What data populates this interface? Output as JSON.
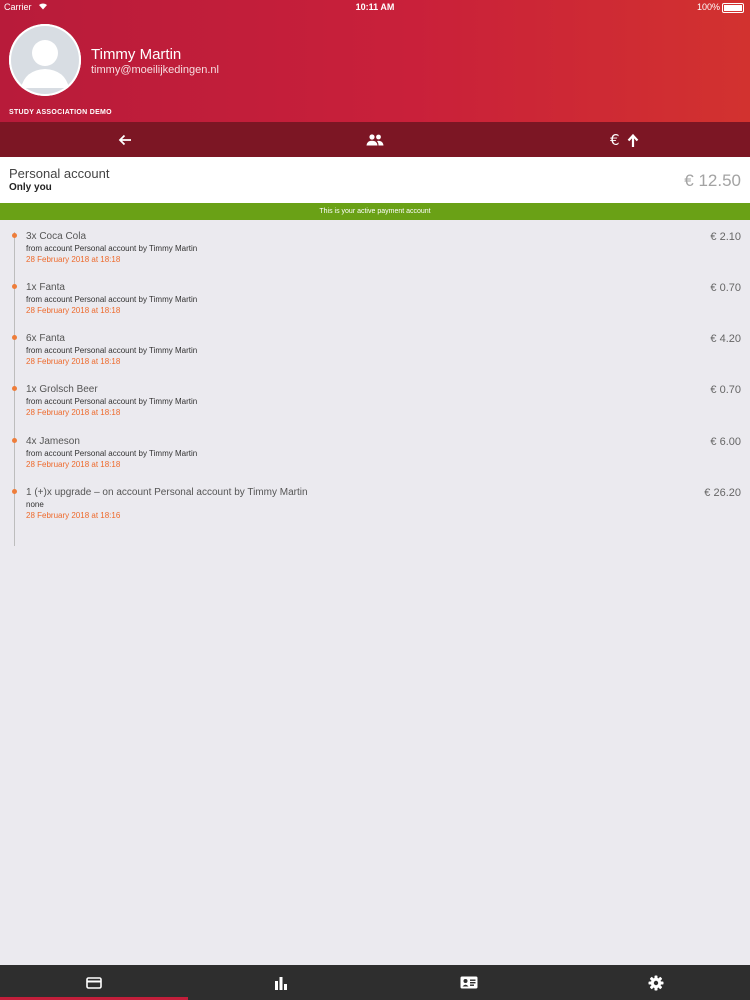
{
  "status_bar": {
    "carrier": "Carrier",
    "time": "10:11 AM",
    "battery": "100%"
  },
  "user": {
    "name": "Timmy Martin",
    "email": "timmy@moeilijkedingen.nl",
    "organization": "STUDY ASSOCIATION DEMO"
  },
  "toolbar": {
    "items": [
      {
        "icon": "arrow-left-icon"
      },
      {
        "icon": "people-icon"
      },
      {
        "icon": "euro-upgrade-icon"
      }
    ]
  },
  "account": {
    "name": "Personal account",
    "owner": "Only you",
    "balance": "€ 12.50",
    "active_notice": "This is your active payment account"
  },
  "transactions": [
    {
      "title": "3x Coca Cola",
      "description": "from account Personal account by Timmy Martin",
      "date": "28 February 2018 at 18:18",
      "amount": "€ 2.10"
    },
    {
      "title": "1x Fanta",
      "description": "from account Personal account by Timmy Martin",
      "date": "28 February 2018 at 18:18",
      "amount": "€ 0.70"
    },
    {
      "title": "6x Fanta",
      "description": "from account Personal account by Timmy Martin",
      "date": "28 February 2018 at 18:18",
      "amount": "€ 4.20"
    },
    {
      "title": "1x Grolsch Beer",
      "description": "from account Personal account by Timmy Martin",
      "date": "28 February 2018 at 18:18",
      "amount": "€ 0.70"
    },
    {
      "title": "4x Jameson",
      "description": "from account Personal account by Timmy Martin",
      "date": "28 February 2018 at 18:18",
      "amount": "€ 6.00"
    },
    {
      "title": "1 (+)x upgrade – on account Personal account by Timmy Martin",
      "description": "none",
      "date": "28 February 2018 at 18:16",
      "amount": "€ 26.20"
    }
  ],
  "tabbar": {
    "items": [
      {
        "icon": "card-icon",
        "active": true
      },
      {
        "icon": "bar-chart-icon",
        "active": false
      },
      {
        "icon": "id-card-icon",
        "active": false
      },
      {
        "icon": "gear-icon",
        "active": false
      }
    ]
  },
  "colors": {
    "header_red": "#c9203a",
    "toolbar_dark_red": "#7c1624",
    "active_green": "#6aa116",
    "date_orange": "#ee6a2c"
  }
}
